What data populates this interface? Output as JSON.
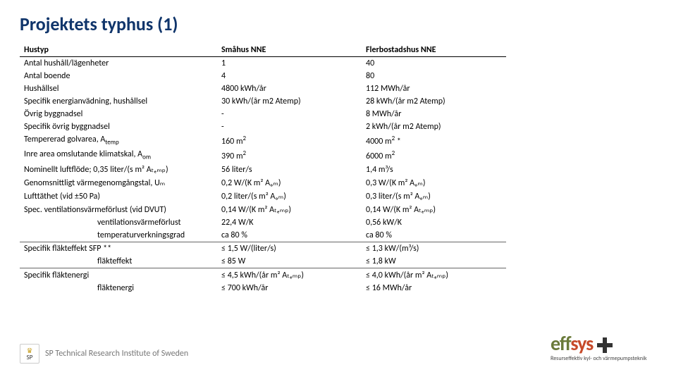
{
  "title": "Projektets typhus (1)",
  "headers": {
    "c0": "Hustyp",
    "c1": "Småhus NNE",
    "c2": "Flerbostadshus NNE"
  },
  "rows": [
    {
      "a": "Antal hushåll/lägenheter",
      "b": "1",
      "c": "40"
    },
    {
      "a": "Antal boende",
      "b": "4",
      "c": "80"
    },
    {
      "a": "Hushållsel",
      "b": "4800 kWh/år",
      "c": "112 MWh/år"
    },
    {
      "a": "Specifik energianvädning, hushållsel",
      "b": "30 kWh/(år m2 Atemp)",
      "c": "28 kWh/(år m2 Atemp)"
    },
    {
      "a": "Övrig byggnadsel",
      "b": "-",
      "c": "8 MWh/år"
    },
    {
      "a": "Specifik övrig byggnadsel",
      "b": "-",
      "c": "2 kWh/(år m2 Atemp)"
    },
    {
      "a": "Tempererad golvarea, A",
      "asub": "temp",
      "b": "160 m",
      "bsup": "2",
      "c": "4000 m",
      "csup": "2",
      "csuffix": " *"
    },
    {
      "a": "Inre area omslutande klimatskal, A",
      "asub": "om",
      "b": "390 m",
      "bsup": "2",
      "c": "6000 m",
      "csup": "2"
    },
    {
      "a": "Nominellt luftflöde; 0,35 liter/(s m² Aₜₑₘₚ)",
      "b": "56 liter/s",
      "c": "1,4 m³/s"
    },
    {
      "a": "Genomsnittligt värmegenomgångstal, Uₘ",
      "b": "0,2 W/(K m² Aₒₘ)",
      "c": "0,3 W/(K m² Aₒₘ)"
    },
    {
      "a": "Lufttäthet (vid ±50 Pa)",
      "b": "0,2 liter/(s m² Aₒₘ)",
      "c": "0,3 liter/(s m² Aₒₘ)"
    },
    {
      "a": "Spec. ventilationsvärmeförlust (vid DVUT)",
      "b": "0,14 W/(K m² Aₜₑₘₚ)",
      "c": "0,14 W/(K m² Aₜₑₘₚ)"
    },
    {
      "a": "ventilationsvärmeförlust",
      "b": "22,4 W/K",
      "c": "0,56 kW/K",
      "indent": true
    },
    {
      "a": "temperaturverkningsgrad",
      "b": "ca 80 %",
      "c": "ca 80 %",
      "indent": true
    },
    {
      "a": "Specifik fläkteffekt SFP **",
      "b": "≤ 1,5 W/(liter/s)",
      "c": "≤ 1,3 kW/(m³/s)",
      "sep": true
    },
    {
      "a": "fläkteffekt",
      "b": "≤ 85 W",
      "c": "≤ 1,8 kW",
      "indent": true
    },
    {
      "a": "Specifik fläktenergi",
      "b": "≤ 4,5 kWh/(år m² Aₜₑₘₚ)",
      "c": "≤ 4,0 kWh/(år m² Aₜₑₘₚ)",
      "sep": true
    },
    {
      "a": "fläktenergi",
      "b": "≤ 700 kWh/år",
      "c": "≤ 16 MWh/år",
      "indent": true
    }
  ],
  "footer": {
    "institute": "SP Technical Research Institute of Sweden"
  },
  "effsys": {
    "tag": "Resurseffektiv kyl- och värmepumpsteknik"
  }
}
